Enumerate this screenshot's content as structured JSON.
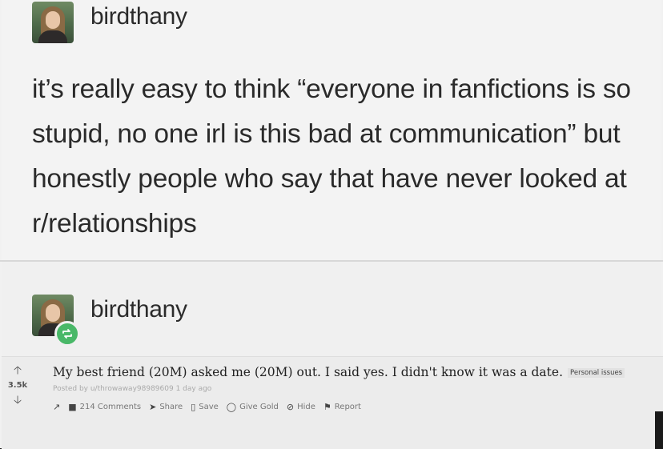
{
  "post": {
    "username": "birdthany",
    "text": "it’s really easy to think “everyone in fanfictions is so stupid, no one irl is this bad at communication” but honestly people who say that have never looked at r/relationships"
  },
  "reblog": {
    "username": "birdthany",
    "badge_icon": "reblog-icon",
    "badge_color": "#49b868"
  },
  "reddit": {
    "score": "3.5k",
    "title": "My best friend (20M) asked me (20M) out. I said yes. I didn't know it was a date.",
    "flair": "Personal issues",
    "meta": "Posted by u/throwaway98989609 1 day ago",
    "actions": {
      "comments": "214 Comments",
      "share": "Share",
      "save": "Save",
      "give_gold": "Give Gold",
      "hide": "Hide",
      "report": "Report"
    }
  }
}
